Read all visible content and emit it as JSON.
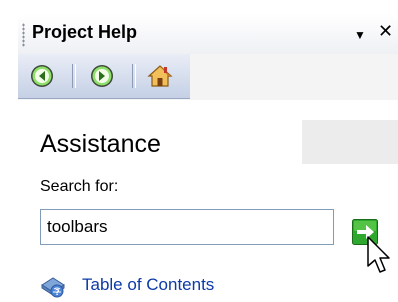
{
  "pane": {
    "title": "Project Help",
    "menu_glyph": "▼",
    "close_glyph": "✕"
  },
  "toolbar": {
    "buttons": [
      {
        "name": "back",
        "icon": "arrow-left-circle-icon"
      },
      {
        "name": "forward",
        "icon": "arrow-right-circle-icon"
      },
      {
        "name": "home",
        "icon": "home-icon"
      }
    ]
  },
  "main": {
    "heading": "Assistance",
    "search_label": "Search for:",
    "search_value": "toolbars",
    "go_icon": "green-arrow-go-icon",
    "toc_icon": "book-globe-icon",
    "toc_label": "Table of Contents"
  },
  "colors": {
    "link": "#0b3aa8",
    "go_green": "#2ea82e",
    "toolbar_blue": "#c5d0e6"
  }
}
